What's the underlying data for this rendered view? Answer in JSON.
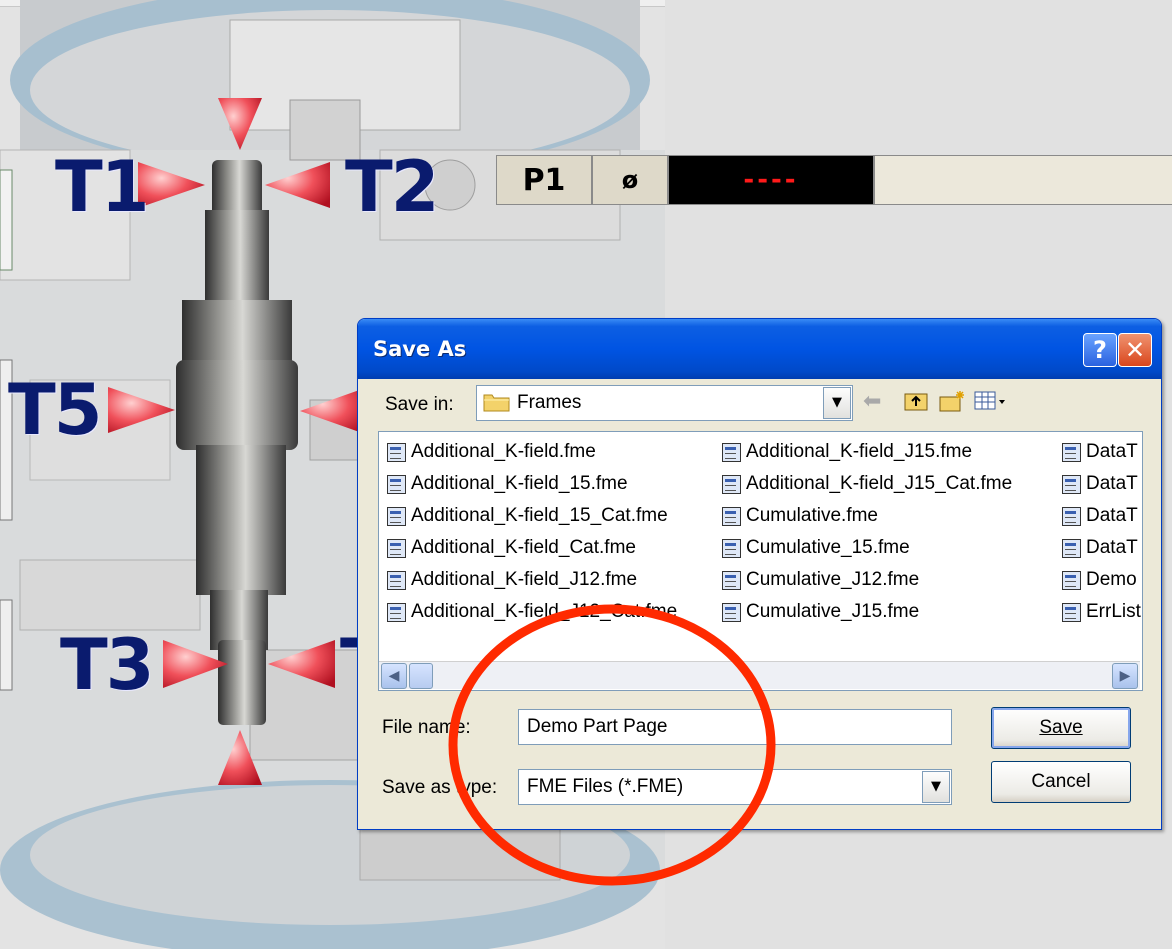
{
  "dialog": {
    "title": "Save As",
    "help_symbol": "?",
    "close_symbol": "✕",
    "save_in_label": "Save in:",
    "save_in_value": "Frames",
    "files_col1": [
      "Additional_K-field.fme",
      "Additional_K-field_15.fme",
      "Additional_K-field_15_Cat.fme",
      "Additional_K-field_Cat.fme",
      "Additional_K-field_J12.fme",
      "Additional_K-field_J12_Cat.fme"
    ],
    "files_col2": [
      "Additional_K-field_J15.fme",
      "Additional_K-field_J15_Cat.fme",
      "Cumulative.fme",
      "Cumulative_15.fme",
      "Cumulative_J12.fme",
      "Cumulative_J15.fme"
    ],
    "files_col3": [
      "DataT",
      "DataT",
      "DataT",
      "DataT",
      "Demo",
      "ErrList"
    ],
    "file_name_label": "File name:",
    "file_name_value": "Demo Part Page",
    "save_type_label": "Save as type:",
    "save_type_value": "FME Files (*.FME)",
    "save_button": "Save",
    "cancel_button": "Cancel"
  },
  "background": {
    "labels": [
      "T1",
      "T2",
      "T5",
      "T3",
      "T"
    ],
    "measure_label": "P1",
    "measure_symbol": "ø",
    "measure_value": "----"
  },
  "colors": {
    "title_bar": "#0054e3",
    "annotation_circle": "#ff2a00",
    "label_text": "#0a1b6e",
    "readout_value": "#ff1a1a"
  }
}
